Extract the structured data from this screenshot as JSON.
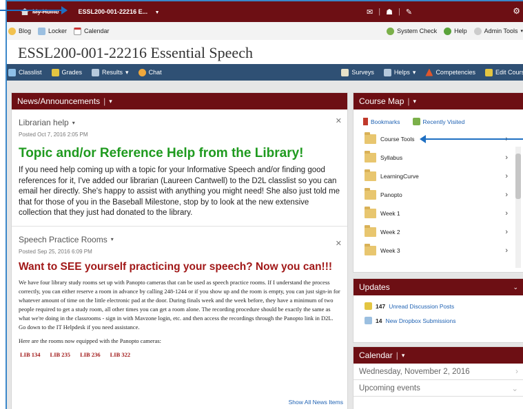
{
  "minibar": {
    "home": "My Home",
    "course": "ESSL200-001-22216 E...",
    "caret": "▼"
  },
  "nav2": {
    "blog": "Blog",
    "locker": "Locker",
    "calendar": "Calendar",
    "system_check": "System Check",
    "help": "Help",
    "admin": "Admin Tools"
  },
  "course_title": "ESSL200-001-22216 Essential Speech",
  "navbar": {
    "classlist": "Classlist",
    "grades": "Grades",
    "results": "Results",
    "chat": "Chat",
    "surveys": "Surveys",
    "helps": "Helps",
    "competencies": "Competencies",
    "edit": "Edit Cours"
  },
  "news": {
    "header": "News/Announcements",
    "items": [
      {
        "title": "Librarian help",
        "posted": "Posted Oct 7, 2016 2:05 PM",
        "heading": "Topic and/or Reference Help from the Library!",
        "body": "If you need help coming up with a topic for your Informative Speech and/or finding good references for it, I've added our librarian (Laureen Cantwell) to the D2L classlist so you can email her directly.  She's happy to assist with anything you might need!  She also just told me that for those of you in the Baseball Milestone, stop by to look at the new extensive collection that they just had donated to the library."
      },
      {
        "title": "Speech Practice Rooms",
        "posted": "Posted Sep 25, 2016 6:09 PM",
        "heading": "Want to SEE yourself practicing your speech?  Now you can!!!",
        "body": "We have four library study rooms set up with Panopto cameras that can be used as speech practice rooms.  If I understand the process correctly, you can either reserve a room in advance by calling 248-1244 or if you show up and the room is empty, you can just sign-in for whatever amount of time on the little electronic pad at the door.  During finals week and the week before, they have a minimum of two people required to get a study room, all other times you can get a room alone.  The recording procedure should be exactly the same as what we're doing in the classrooms - sign in with Mavzone login, etc. and then access the recordings through the Panopto link in D2L.  Go down to the IT Helpdesk if you need assistance.",
        "rooms_intro": "Here are the rooms now equipped with the Panopto cameras:",
        "rooms": [
          "LIB 134",
          "LIB 235",
          "LIB 236",
          "LIB 322"
        ]
      }
    ],
    "show_all": "Show All News Items"
  },
  "course_map": {
    "header": "Course Map",
    "bookmarks": "Bookmarks",
    "recent": "Recently Visited",
    "items": [
      "Course Tools",
      "Syllabus",
      "LearningCurve",
      "Panopto",
      "Week 1",
      "Week 2",
      "Week 3"
    ]
  },
  "updates": {
    "header": "Updates",
    "discussion_count": "147",
    "discussion_label": "Unread Discussion Posts",
    "dropbox_count": "14",
    "dropbox_label": "New Dropbox Submissions"
  },
  "calendar": {
    "header": "Calendar",
    "date": "Wednesday, November 2, 2016",
    "upcoming": "Upcoming events"
  },
  "colors": {
    "brand": "#6d0f14",
    "nav": "#2f5074",
    "annotation_arrow": "#1e6fc2"
  }
}
